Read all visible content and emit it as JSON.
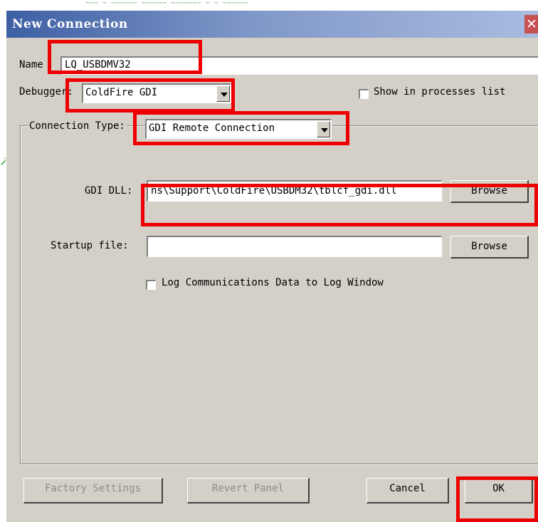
{
  "window": {
    "title": "New Connection",
    "close_symbol": "✕"
  },
  "name": {
    "label": "Name",
    "value": "LQ_USBDMV32"
  },
  "debugger": {
    "label": "Debugger:",
    "value": "ColdFire GDI"
  },
  "show_in_processes": {
    "label": "Show in processes list",
    "checked": false
  },
  "connection_type": {
    "label": "Connection Type:",
    "value": "GDI Remote Connection"
  },
  "gdi_dll": {
    "label": "GDI DLL:",
    "value": "ns\\Support\\ColdFire\\USBDM32\\tblcf_gdi.dll",
    "browse_label": "Browse"
  },
  "startup_file": {
    "label": "Startup file:",
    "value": "",
    "browse_label": "Browse"
  },
  "log_communications": {
    "label": "Log Communications Data to Log Window",
    "checked": false
  },
  "buttons": {
    "factory_settings": "Factory Settings",
    "revert_panel": "Revert Panel",
    "cancel": "Cancel",
    "ok": "OK"
  },
  "colors": {
    "annotation": "#ee0000",
    "dialog_bg": "#d4d0c8",
    "title_start": "#3d5fa3",
    "title_end": "#a9bbdf"
  }
}
